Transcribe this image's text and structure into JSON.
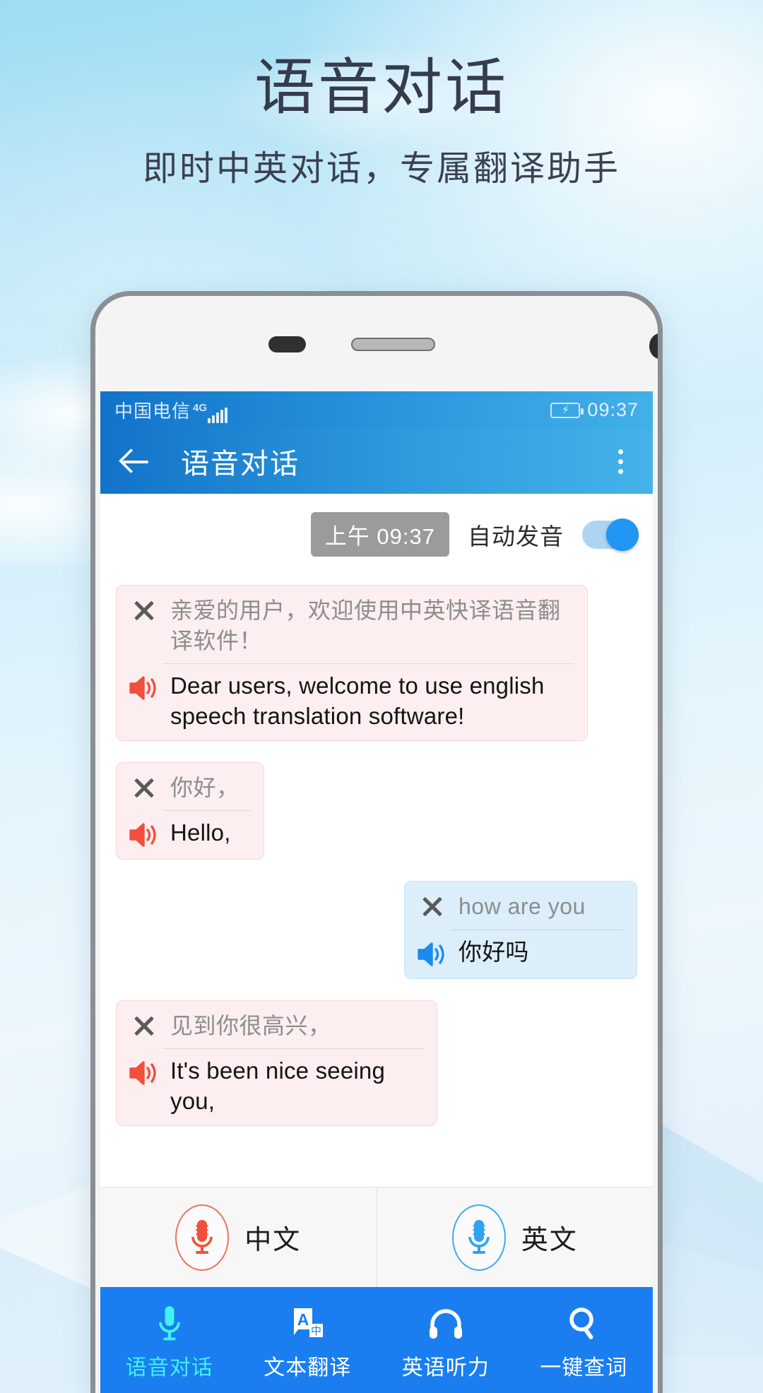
{
  "hero": {
    "title": "语音对话",
    "subtitle": "即时中英对话，专属翻译助手"
  },
  "colors": {
    "toolbar_blue": "#2e9ade",
    "nav_blue": "#1a7ef0",
    "accent_cyan": "#41f2ef",
    "bubble_left_bg": "#fdeef0",
    "bubble_right_bg": "#dbeefa",
    "speaker_red": "#f0503c",
    "speaker_blue": "#1a8cf0",
    "switch_on": "#2196f3"
  },
  "phone": {
    "statusbar": {
      "carrier": "中国电信",
      "network": "4G",
      "battery_icon": "battery-charging-icon",
      "time": "09:37"
    },
    "toolbar": {
      "back_icon": "back-arrow-icon",
      "title": "语音对话",
      "menu_icon": "overflow-menu-icon"
    },
    "chat": {
      "timestamp_badge": "上午 09:37",
      "autoplay_label": "自动发音",
      "autoplay_on": true,
      "messages": [
        {
          "side": "left",
          "close_icon": "close-icon",
          "speaker_icon": "speaker-icon",
          "source": "亲爱的用户，欢迎使用中英快译语音翻译软件！",
          "translation": "Dear users, welcome to use english speech translation software!"
        },
        {
          "side": "left",
          "close_icon": "close-icon",
          "speaker_icon": "speaker-icon",
          "source": "你好，",
          "translation": "Hello,"
        },
        {
          "side": "right",
          "close_icon": "close-icon",
          "speaker_icon": "speaker-icon",
          "source": "how are you",
          "translation": "你好吗"
        },
        {
          "side": "left",
          "close_icon": "close-icon",
          "speaker_icon": "speaker-icon",
          "source": "见到你很高兴，",
          "translation": "It's been nice seeing you,"
        }
      ]
    },
    "mic_row": [
      {
        "icon": "microphone-icon",
        "label": "中文",
        "accent": "red"
      },
      {
        "icon": "microphone-icon",
        "label": "英文",
        "accent": "blue"
      }
    ],
    "bottom_nav": [
      {
        "icon": "microphone-icon",
        "label": "语音对话",
        "active": true
      },
      {
        "icon": "text-translate-icon",
        "label": "文本翻译",
        "active": false
      },
      {
        "icon": "headphones-icon",
        "label": "英语听力",
        "active": false
      },
      {
        "icon": "search-icon",
        "label": "一键查词",
        "active": false
      }
    ]
  }
}
